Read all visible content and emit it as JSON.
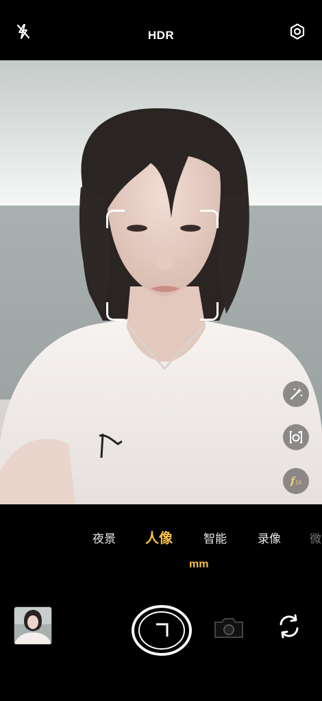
{
  "top_bar": {
    "flash_icon": "flash-off-icon",
    "title": "HDR",
    "settings_icon": "settings-icon"
  },
  "viewfinder": {
    "face_frame": "face-detection-frame",
    "side_controls": [
      {
        "icon": "beauty-wand-icon"
      },
      {
        "icon": "portrait-filter-icon"
      },
      {
        "icon": "aperture-icon",
        "label": "f",
        "value": "16"
      }
    ]
  },
  "modes": {
    "items": [
      "夜景",
      "人像",
      "智能",
      "录像",
      "微"
    ],
    "active": "人像"
  },
  "zoom": {
    "items": [
      "",
      "",
      "",
      "mm"
    ]
  },
  "bottom_controls": {
    "gallery_thumbnail": "gallery-thumbnail",
    "shutter": "shutter-button",
    "camera_mode": "camera-mode-icon",
    "switch_camera": "switch-camera-icon"
  },
  "colors": {
    "accent": "#f6c146",
    "background": "#000000"
  }
}
